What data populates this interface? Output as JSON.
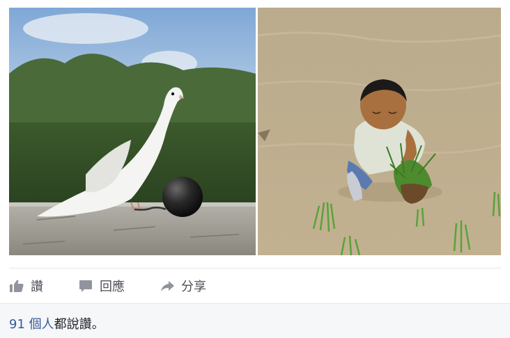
{
  "actions": {
    "like_label": "讚",
    "comment_label": "回應",
    "share_label": "分享"
  },
  "likes": {
    "count_link": "91 個人",
    "suffix": "都說讚。"
  },
  "colors": {
    "action_icon": "#90949c",
    "link": "#365899",
    "footer_bg": "#f6f7f9"
  }
}
